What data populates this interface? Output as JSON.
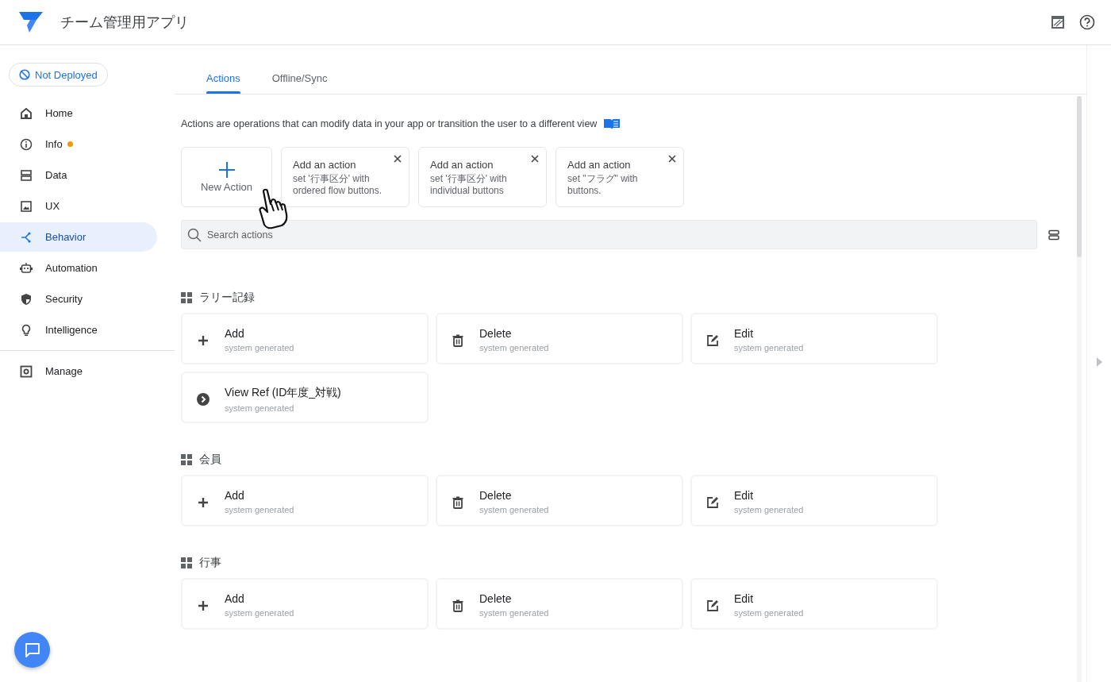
{
  "app": {
    "title": "チーム管理用アプリ"
  },
  "deploy_status": {
    "label": "Not Deployed"
  },
  "sidebar": {
    "items": [
      {
        "kind": "home",
        "label": "Home",
        "selected": false,
        "notification": false
      },
      {
        "kind": "info",
        "label": "Info",
        "selected": false,
        "notification": true
      },
      {
        "kind": "data",
        "label": "Data",
        "selected": false,
        "notification": false
      },
      {
        "kind": "ux",
        "label": "UX",
        "selected": false,
        "notification": false
      },
      {
        "kind": "behavior",
        "label": "Behavior",
        "selected": true,
        "notification": false
      },
      {
        "kind": "automation",
        "label": "Automation",
        "selected": false,
        "notification": false
      },
      {
        "kind": "security",
        "label": "Security",
        "selected": false,
        "notification": false
      },
      {
        "kind": "intelligence",
        "label": "Intelligence",
        "selected": false,
        "notification": false
      }
    ],
    "footer_items": [
      {
        "kind": "manage",
        "label": "Manage",
        "selected": false,
        "notification": false
      }
    ]
  },
  "tabs": [
    {
      "label": "Actions",
      "selected": true
    },
    {
      "label": "Offline/Sync",
      "selected": false
    }
  ],
  "description": "Actions are operations that can modify data in your app or transition the user to a different view",
  "new_action": {
    "label": "New Action"
  },
  "suggestions": [
    {
      "title": "Add an action",
      "text": "set '行事区分' with ordered flow buttons."
    },
    {
      "title": "Add an action",
      "text": "set '行事区分' with individual buttons"
    },
    {
      "title": "Add an action",
      "text": "set \"フラグ\" with buttons."
    }
  ],
  "search": {
    "placeholder": "Search actions"
  },
  "groups": [
    {
      "name": "ラリー記録",
      "actions": [
        {
          "kind": "add",
          "name": "Add",
          "subtitle": "system generated"
        },
        {
          "kind": "delete",
          "name": "Delete",
          "subtitle": "system generated"
        },
        {
          "kind": "edit",
          "name": "Edit",
          "subtitle": "system generated"
        },
        {
          "kind": "view",
          "name": "View Ref (ID年度_対戦)",
          "subtitle": "system generated"
        }
      ]
    },
    {
      "name": "会員",
      "actions": [
        {
          "kind": "add",
          "name": "Add",
          "subtitle": "system generated"
        },
        {
          "kind": "delete",
          "name": "Delete",
          "subtitle": "system generated"
        },
        {
          "kind": "edit",
          "name": "Edit",
          "subtitle": "system generated"
        }
      ]
    },
    {
      "name": "行事",
      "actions": [
        {
          "kind": "add",
          "name": "Add",
          "subtitle": "system generated"
        },
        {
          "kind": "delete",
          "name": "Delete",
          "subtitle": "system generated"
        },
        {
          "kind": "edit",
          "name": "Edit",
          "subtitle": "system generated"
        }
      ]
    }
  ]
}
